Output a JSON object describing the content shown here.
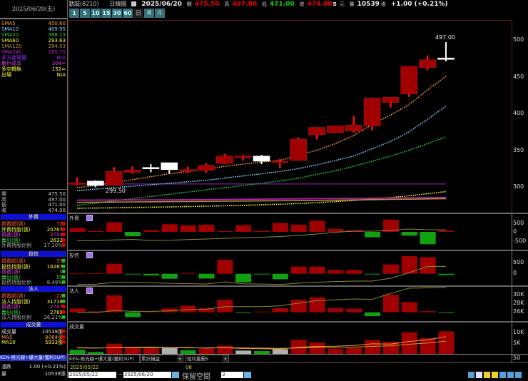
{
  "header": {
    "stock": "勤誠(8210)",
    "chart_type": "日線圖",
    "date": "2025/06/20",
    "open_label": "開",
    "open": "475.50",
    "high_label": "高",
    "high": "497.00",
    "low_label": "低",
    "low": "471.00",
    "close_label": "收",
    "close": "474.00",
    "currency_flag": "s",
    "currency": "元",
    "volume_label": "量",
    "volume": "10539",
    "volume_unit": "張",
    "change": "+1.00 (+0.21%)"
  },
  "periods": [
    "1",
    "5",
    "10",
    "15",
    "30",
    "60",
    "日",
    "週",
    "月"
  ],
  "left": {
    "date": "2025/06/20(五)",
    "ma": [
      {
        "label": "SMA5",
        "value": "450.60",
        "color": "#ff9a30"
      },
      {
        "label": "SMA10",
        "value": "409.95",
        "color": "#80d0ff"
      },
      {
        "label": "SMA20",
        "value": "368.13",
        "color": "#20d040"
      },
      {
        "label": "SMA60",
        "value": "293.63",
        "color": "#ffff30"
      },
      {
        "label": "SMA120",
        "value": "284.03",
        "color": "#b09040"
      },
      {
        "label": "SMA240",
        "value": "285.75",
        "color": "#c020c0"
      }
    ],
    "levels": [
      {
        "label": "多方進場價",
        "value": "N/A",
        "color": "#9030ff"
      },
      {
        "label": "散戶成本",
        "value": "304=",
        "color": "#e040e0"
      },
      {
        "label": "多空轉換",
        "value": "152=",
        "color": "#ffff40"
      },
      {
        "label": "出場",
        "value": "N/A",
        "color": "#ffff40"
      }
    ],
    "ohlc": [
      {
        "label": "開",
        "value": "475.50"
      },
      {
        "label": "高",
        "value": "497.00"
      },
      {
        "label": "低",
        "value": "471.00"
      },
      {
        "label": "收",
        "value": "474.00"
      }
    ],
    "sections": [
      {
        "title": "外資",
        "rows": [
          {
            "label": "買賣超(張)",
            "value": "72",
            "lc": "#ff6030",
            "vc": "#ff6030",
            "arrow": "up"
          },
          {
            "label": "外資持股(張)",
            "value": "20767",
            "lc": "#ffff40",
            "vc": "#ffff40",
            "arrow": "up"
          },
          {
            "label": "買進(張)",
            "value": "2704",
            "lc": "#e040e0",
            "vc": "#e040e0",
            "arrow": "up"
          },
          {
            "label": "賣出(張)",
            "value": "2632",
            "lc": "#40e040",
            "vc": "#ffff40",
            "arrow": "up"
          },
          {
            "label": "外資持股比例",
            "value": "17.10%",
            "lc": "#aaa",
            "vc": "#aaa",
            "arrow": "up"
          }
        ]
      },
      {
        "title": "投信",
        "rows": [
          {
            "label": "買賣超(張)",
            "value": "-55",
            "lc": "#ff6030",
            "vc": "#ff6030",
            "arrow": "down"
          },
          {
            "label": "投信持股(張)",
            "value": "10267",
            "lc": "#ffff40",
            "vc": "#ffff40",
            "arrow": "down"
          },
          {
            "label": "買進(張)",
            "value": "0",
            "lc": "#e040e0",
            "vc": "#e040e0",
            "arrow": "down"
          },
          {
            "label": "賣出(張)",
            "value": "55",
            "lc": "#40e040",
            "vc": "#40e040",
            "arrow": "down"
          },
          {
            "label": "投信持股比例",
            "value": "8.49%",
            "lc": "#aaa",
            "vc": "#aaa",
            "arrow": "down"
          }
        ]
      },
      {
        "title": "法人",
        "rows": [
          {
            "label": "買賣超(張)",
            "value": "-22",
            "lc": "#ff6030",
            "vc": "#ff6030",
            "arrow": "down"
          },
          {
            "label": "法人持股(張)",
            "value": "31718",
            "lc": "#ffff40",
            "vc": "#ffff40",
            "arrow": "down"
          },
          {
            "label": "買進(張)",
            "value": "2747",
            "lc": "#e040e0",
            "vc": "#e040e0",
            "arrow": "up"
          },
          {
            "label": "賣出(張)",
            "value": "2769",
            "lc": "#40e040",
            "vc": "#ffff40",
            "arrow": "up"
          },
          {
            "label": "法人持股比例",
            "value": "26.21%",
            "lc": "#aaa",
            "vc": "#aaa",
            "arrow": "down"
          }
        ]
      },
      {
        "title": "成交量",
        "rows": [
          {
            "label": "成交量",
            "value": "10539張",
            "lc": "#ddd",
            "vc": "#ddd",
            "arrow": "up"
          },
          {
            "label": "MA5",
            "value": "8064張",
            "lc": "#ff9a30",
            "vc": "#ff9a30",
            "arrow": "up"
          },
          {
            "label": "MA10",
            "value": "5933張",
            "lc": "#ffff40",
            "vc": "#ffff40",
            "arrow": "up"
          }
        ]
      }
    ],
    "strategy": "KEN-極光線+爆大量(獲利3UP)",
    "change_label": "漲跌",
    "change_value": "1.00 (+0.21%)",
    "vol_label": "量",
    "vol_value": "10539張"
  },
  "panels": {
    "foreign": {
      "title": "外資",
      "ticks": [
        "500",
        "0",
        "-500"
      ]
    },
    "trust": {
      "title": "投信",
      "ticks": [
        "500",
        "0"
      ]
    },
    "inst": {
      "title": "法人",
      "ticks": [
        "30K",
        "28K",
        "26K"
      ]
    },
    "volume": {
      "title": "成交量",
      "ticks": [
        "10K",
        "5K"
      ]
    },
    "extra_tick": "50"
  },
  "bottom": {
    "dropdowns": [
      "KEN-極光線+爆大量(獲利3UP)",
      "累計損益",
      "短均量圖5"
    ],
    "x_labels": [
      "2025/05/22",
      "06"
    ],
    "from_date": "2025/05/22",
    "tilde": "~",
    "to_date": "2025/06/20",
    "reserve_label": "保留空間",
    "reserve_value": "3"
  },
  "chart_data": {
    "type": "candlestick",
    "price_ticks": [
      500,
      450,
      400,
      350,
      300
    ],
    "ylim": [
      270,
      525
    ],
    "annotations": [
      {
        "text": "497.00",
        "price": 497
      },
      {
        "text": "299.50",
        "price": 299.5
      }
    ],
    "colors": {
      "up": "#a00000",
      "up_wick": "#ff1010",
      "flat": "#ffffff",
      "down": "#10a010",
      "gray": "#b0b0b0"
    },
    "candles": [
      {
        "o": 305,
        "h": 313,
        "l": 302,
        "c": 305.5,
        "k": "up"
      },
      {
        "o": 308,
        "h": 309,
        "l": 299.5,
        "c": 302,
        "k": "flat"
      },
      {
        "o": 302,
        "h": 327,
        "l": 302,
        "c": 321,
        "k": "up"
      },
      {
        "o": 320,
        "h": 328,
        "l": 318,
        "c": 323,
        "k": "up"
      },
      {
        "o": 326,
        "h": 331,
        "l": 320,
        "c": 326.5,
        "k": "flat"
      },
      {
        "o": 333,
        "h": 333,
        "l": 318,
        "c": 323.5,
        "k": "flat"
      },
      {
        "o": 322.5,
        "h": 327.5,
        "l": 318.5,
        "c": 323.5,
        "k": "up"
      },
      {
        "o": 322.5,
        "h": 332,
        "l": 319.5,
        "c": 329.5,
        "k": "up"
      },
      {
        "o": 332,
        "h": 345,
        "l": 331,
        "c": 342,
        "k": "up"
      },
      {
        "o": 340,
        "h": 343.5,
        "l": 336,
        "c": 342,
        "k": "up"
      },
      {
        "o": 342,
        "h": 343.5,
        "l": 331,
        "c": 335,
        "k": "flat"
      },
      {
        "o": 334,
        "h": 338,
        "l": 325.5,
        "c": 335,
        "k": "up"
      },
      {
        "o": 336,
        "h": 367.5,
        "l": 336,
        "c": 365,
        "k": "up"
      },
      {
        "o": 371,
        "h": 381.5,
        "l": 364.5,
        "c": 381,
        "k": "up"
      },
      {
        "o": 374,
        "h": 383,
        "l": 373,
        "c": 383,
        "k": "up"
      },
      {
        "o": 376,
        "h": 396.5,
        "l": 374,
        "c": 384,
        "k": "up"
      },
      {
        "o": 383,
        "h": 421,
        "l": 377,
        "c": 421,
        "k": "up"
      },
      {
        "o": 415,
        "h": 422,
        "l": 408,
        "c": 422,
        "k": "up"
      },
      {
        "o": 426.5,
        "h": 464,
        "l": 422.5,
        "c": 464,
        "k": "up"
      },
      {
        "o": 462.5,
        "h": 479,
        "l": 459,
        "c": 473,
        "k": "up"
      },
      {
        "o": 475.5,
        "h": 497,
        "l": 471,
        "c": 474,
        "k": "flat"
      }
    ],
    "ma_series": [
      {
        "name": "SMA5",
        "color": "#ff9a30",
        "values": [
          299,
          302,
          306,
          310,
          314,
          318,
          321,
          324,
          328,
          331,
          334,
          336,
          343,
          350,
          359,
          370,
          385,
          398,
          412,
          432,
          450.6
        ]
      },
      {
        "name": "SMA10",
        "color": "#80d0ff",
        "values": [
          295,
          297,
          299,
          301,
          303,
          305,
          307,
          309,
          312,
          315,
          318,
          321,
          325,
          330,
          336,
          342,
          352,
          362,
          375,
          392,
          409.95
        ]
      },
      {
        "name": "SMA20",
        "color": "#20d040",
        "values": [
          275,
          278,
          281,
          284,
          287,
          290,
          293,
          296,
          299,
          302,
          305,
          308,
          312,
          317,
          322,
          328,
          335,
          342,
          350,
          359,
          368.13
        ]
      },
      {
        "name": "SMA60",
        "color": "#ffff30",
        "values": [
          271,
          271.3,
          271.6,
          272,
          272.4,
          272.8,
          273.3,
          273.8,
          274.4,
          275,
          275.7,
          276.5,
          277.5,
          278.6,
          280,
          281.6,
          283.4,
          285.5,
          288,
          290.8,
          293.63
        ]
      },
      {
        "name": "SMA120",
        "color": "#b09040",
        "values": [
          279,
          279.2,
          279.4,
          279.6,
          279.8,
          280,
          280.2,
          280.4,
          280.6,
          280.8,
          281,
          281.2,
          281.4,
          281.7,
          282,
          282.3,
          282.6,
          283,
          283.3,
          283.7,
          284.03
        ]
      },
      {
        "name": "SMA240",
        "color": "#c020c0",
        "values": [
          282,
          282.1,
          282.2,
          282.3,
          282.4,
          282.5,
          282.6,
          282.8,
          283,
          283.2,
          283.4,
          283.6,
          283.8,
          284,
          284.2,
          284.4,
          284.6,
          284.9,
          285.2,
          285.5,
          285.75
        ]
      }
    ],
    "retail_cost": 304,
    "foreign_net": [
      215,
      55,
      540,
      -245,
      95,
      430,
      365,
      405,
      27,
      380,
      55,
      500,
      405,
      620,
      165,
      95,
      -300,
      690,
      -215,
      -690,
      72
    ],
    "foreign_line": [
      -480,
      -500,
      -450,
      -420,
      -480,
      -470,
      -430,
      -400,
      -360,
      -330,
      -300,
      -260,
      -200,
      -120,
      -20,
      40,
      40,
      80,
      160,
      120,
      110
    ],
    "trust_net": [
      20,
      30,
      447,
      -30,
      -75,
      -223,
      20,
      -213,
      628,
      -383,
      -20,
      -245,
      320,
      320,
      170,
      170,
      -10,
      415,
      787,
      745,
      -55
    ],
    "trust_line": [
      -480,
      -470,
      -380,
      -380,
      -400,
      -430,
      -440,
      -460,
      -360,
      -450,
      -460,
      -480,
      -420,
      -380,
      -350,
      -330,
      -330,
      -200,
      50,
      330,
      330
    ],
    "inst_net": [
      160,
      40,
      710,
      -200,
      20,
      160,
      280,
      180,
      530,
      -30,
      20,
      170,
      530,
      630,
      170,
      150,
      -160,
      740,
      430,
      50,
      -22
    ],
    "inst_holding": [
      25900,
      25800,
      26300,
      26100,
      26100,
      26200,
      26500,
      26600,
      27200,
      27200,
      27200,
      27400,
      28000,
      28600,
      28800,
      29000,
      28900,
      30300,
      31500,
      31600,
      31718
    ],
    "volume": [
      1900,
      890,
      4780,
      3330,
      2670,
      2780,
      1670,
      2560,
      3890,
      1560,
      1330,
      2220,
      6560,
      5330,
      2440,
      2890,
      6440,
      5670,
      10110,
      7330,
      10539
    ],
    "volume_kind": [
      "down",
      "down",
      "up",
      "up",
      "up",
      "flat",
      "down",
      "up",
      "up",
      "flat",
      "down",
      "flat",
      "up",
      "up",
      "up",
      "up",
      "up",
      "up",
      "up",
      "up",
      "up"
    ],
    "volume_ma5": [
      2800,
      2700,
      2900,
      3100,
      3200,
      3000,
      3000,
      2700,
      2900,
      2500,
      2400,
      2300,
      3100,
      3500,
      3600,
      3900,
      4700,
      4600,
      5800,
      6600,
      8064
    ],
    "volume_ma10": [
      2900,
      2800,
      2850,
      2900,
      2950,
      2900,
      2800,
      2850,
      2900,
      2800,
      2700,
      2600,
      2800,
      2900,
      3000,
      3200,
      3500,
      3800,
      4500,
      5100,
      5933
    ]
  }
}
